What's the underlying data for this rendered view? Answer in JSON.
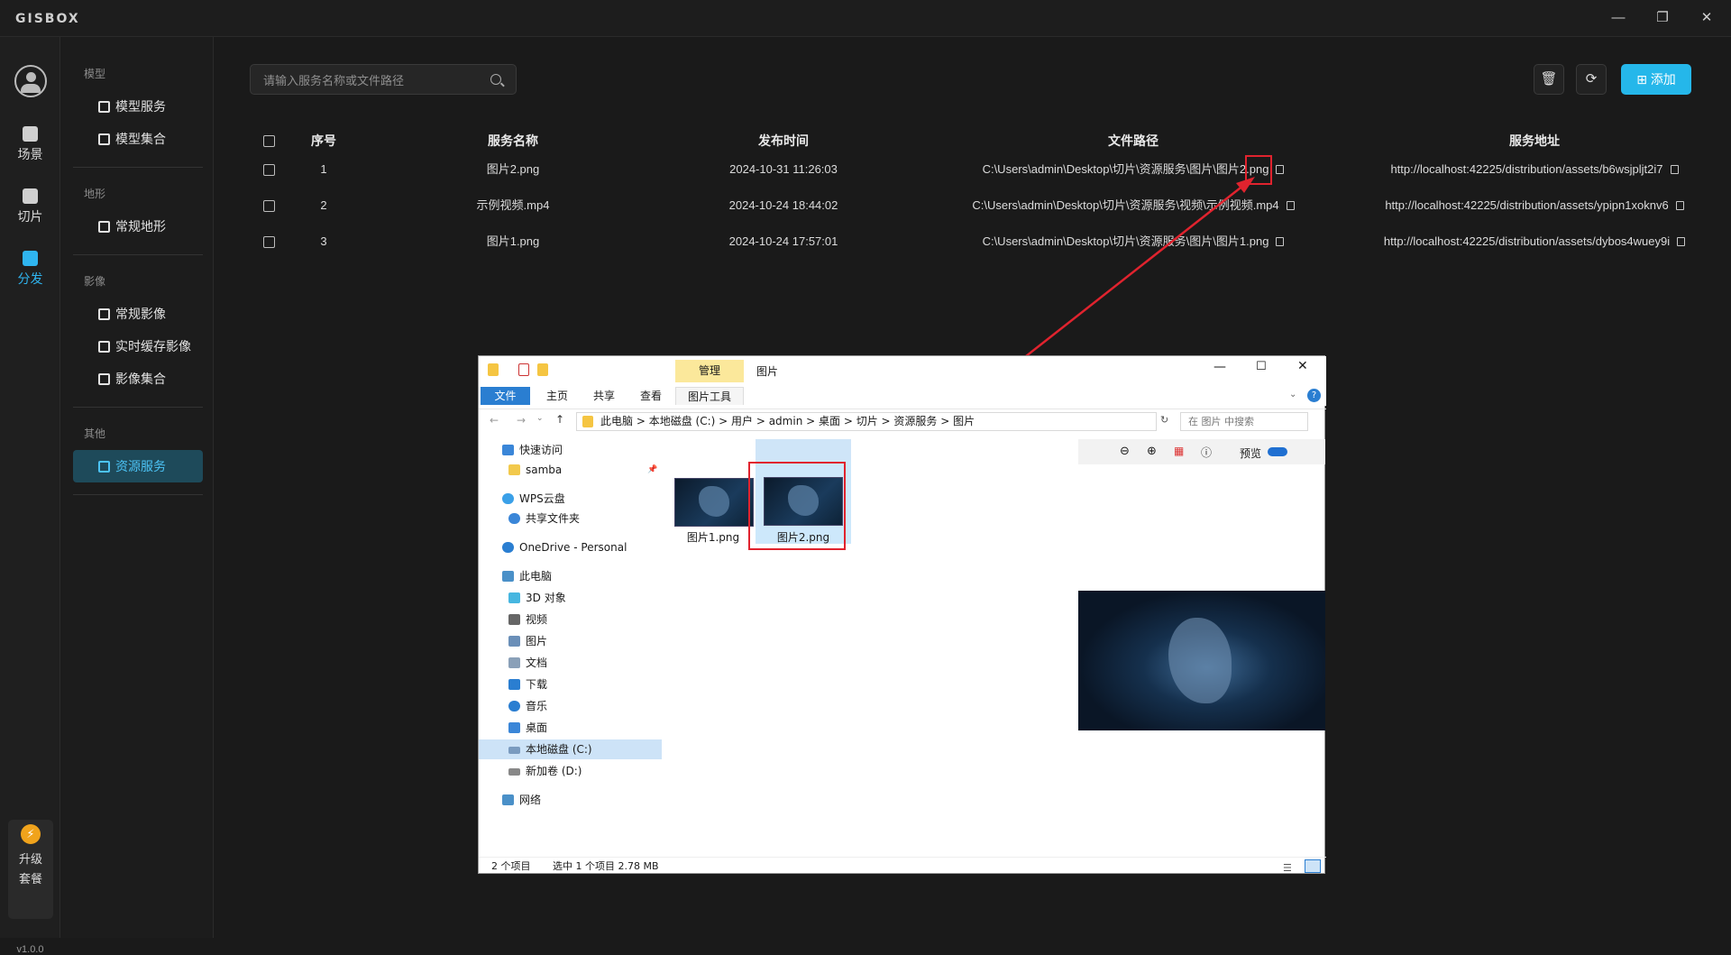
{
  "app": {
    "logo": "GISBOX",
    "window_controls": [
      "minimize-icon",
      "maximize-icon",
      "close-icon"
    ],
    "version": "v1.0.0"
  },
  "rail": {
    "items": [
      {
        "label": "场景",
        "icon": "scene-icon"
      },
      {
        "label": "切片",
        "icon": "tile-icon"
      },
      {
        "label": "分发",
        "icon": "distribute-icon",
        "active": true
      }
    ],
    "upgrade": {
      "line1": "升级",
      "line2": "套餐"
    }
  },
  "sidebar": {
    "groups": [
      {
        "title": "模型",
        "items": [
          "模型服务",
          "模型集合"
        ]
      },
      {
        "title": "地形",
        "items": [
          "常规地形"
        ]
      },
      {
        "title": "影像",
        "items": [
          "常规影像",
          "实时缓存影像",
          "影像集合"
        ]
      },
      {
        "title": "其他",
        "items": [
          "资源服务"
        ]
      }
    ],
    "active_item": "资源服务"
  },
  "toolbar": {
    "search_placeholder": "请输入服务名称或文件路径",
    "add_label": "添加",
    "accent": "#25b7ea"
  },
  "table": {
    "headers": [
      "序号",
      "服务名称",
      "发布时间",
      "文件路径",
      "服务地址"
    ],
    "rows": [
      {
        "idx": "1",
        "name": "图片2.png",
        "time": "2024-10-31 11:26:03",
        "path": "C:\\Users\\admin\\Desktop\\切片\\资源服务\\图片\\图片2.png",
        "url": "http://localhost:42225/distribution/assets/b6wsjpljt2i7"
      },
      {
        "idx": "2",
        "name": "示例视频.mp4",
        "time": "2024-10-24 18:44:02",
        "path": "C:\\Users\\admin\\Desktop\\切片\\资源服务\\视频\\示例视频.mp4",
        "url": "http://localhost:42225/distribution/assets/ypipn1xoknv6"
      },
      {
        "idx": "3",
        "name": "图片1.png",
        "time": "2024-10-24 17:57:01",
        "path": "C:\\Users\\admin\\Desktop\\切片\\资源服务\\图片\\图片1.png",
        "url": "http://localhost:42225/distribution/assets/dybos4wuey9i"
      }
    ]
  },
  "explorer": {
    "title": "图片",
    "context_group": "管理",
    "tabs": [
      "文件",
      "主页",
      "共享",
      "查看",
      "图片工具"
    ],
    "breadcrumb": [
      "此电脑",
      "本地磁盘 (C:)",
      "用户",
      "admin",
      "桌面",
      "切片",
      "资源服务",
      "图片"
    ],
    "search_placeholder": "在 图片 中搜索",
    "nav": [
      {
        "label": "快速访问",
        "indent": 0,
        "color": "#3a86d8"
      },
      {
        "label": "samba",
        "indent": 1,
        "color": "#f2c94c"
      },
      {
        "label": "WPS云盘",
        "indent": 0,
        "color": "#3aa0e8"
      },
      {
        "label": "共享文件夹",
        "indent": 1,
        "color": "#3a86d8"
      },
      {
        "label": "OneDrive - Personal",
        "indent": 0,
        "color": "#2a7ed1"
      },
      {
        "label": "此电脑",
        "indent": 0,
        "color": "#4a90c8"
      },
      {
        "label": "3D 对象",
        "indent": 1,
        "color": "#46b6e0"
      },
      {
        "label": "视频",
        "indent": 1,
        "color": "#666666"
      },
      {
        "label": "图片",
        "indent": 1,
        "color": "#6a8fb8"
      },
      {
        "label": "文档",
        "indent": 1,
        "color": "#8aa0b8"
      },
      {
        "label": "下载",
        "indent": 1,
        "color": "#2a7ed1"
      },
      {
        "label": "音乐",
        "indent": 1,
        "color": "#2a7ed1"
      },
      {
        "label": "桌面",
        "indent": 1,
        "color": "#3a86d8"
      },
      {
        "label": "本地磁盘 (C:)",
        "indent": 1,
        "color": "#7a9bbf",
        "selected": true
      },
      {
        "label": "新加卷 (D:)",
        "indent": 1,
        "color": "#888888"
      },
      {
        "label": "网络",
        "indent": 0,
        "color": "#4a90c8"
      }
    ],
    "files": [
      {
        "name": "图片1.png"
      },
      {
        "name": "图片2.png",
        "selected": true
      }
    ],
    "preview_label": "预览",
    "status": {
      "count": "2 个项目",
      "selected": "选中 1 个项目  2.78 MB"
    }
  }
}
